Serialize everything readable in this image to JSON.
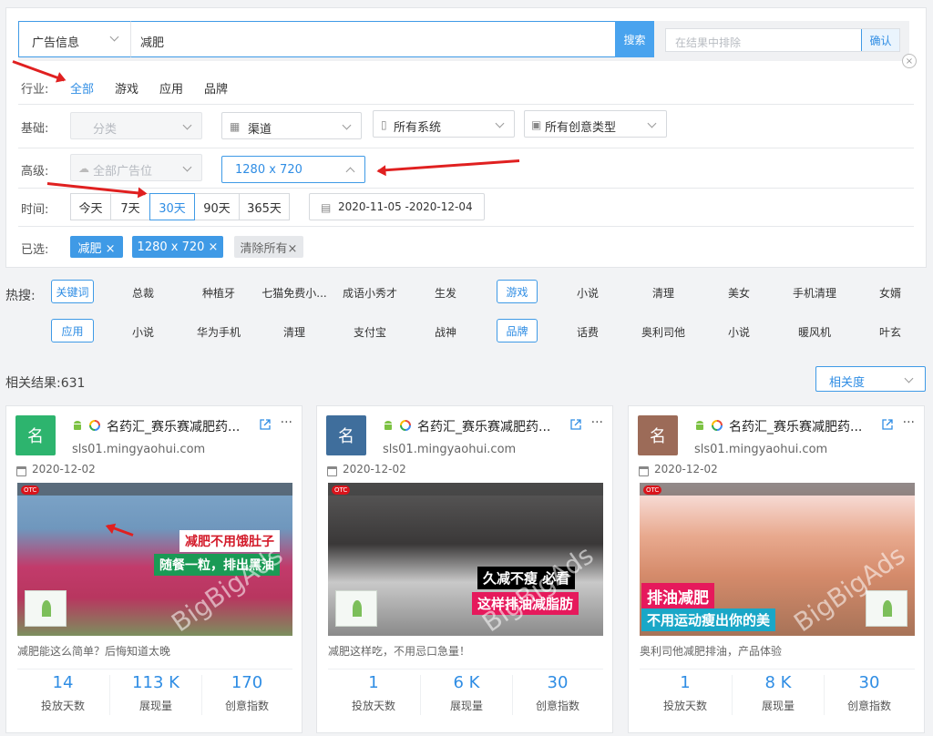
{
  "search": {
    "category": "广告信息",
    "keyword": "减肥",
    "search_label": "搜索",
    "exclude_placeholder": "在结果中排除",
    "confirm_label": "确认"
  },
  "filters": {
    "industry_label": "行业:",
    "industries": [
      "全部",
      "游戏",
      "应用",
      "品牌"
    ],
    "basic_label": "基础:",
    "basic": {
      "category": "分类",
      "channel": "渠道",
      "system": "所有系统",
      "creative_type": "所有创意类型"
    },
    "advanced_label": "高级:",
    "advanced": {
      "placement": "全部广告位",
      "size": "1280 x 720"
    },
    "time_label": "时间:",
    "times": [
      "今天",
      "7天",
      "30天",
      "90天",
      "365天"
    ],
    "date_range": "2020-11-05 -2020-12-04",
    "selected_label": "已选:",
    "selected": [
      "减肥 ×",
      "1280 x 720 ×"
    ],
    "clear_all": "清除所有×"
  },
  "hot": {
    "label": "热搜:",
    "rows": [
      {
        "tag": "关键词",
        "items": [
          "总裁",
          "种植牙",
          "七猫免费小...",
          "成语小秀才",
          "生发"
        ],
        "tag2": "游戏",
        "items2": [
          "小说",
          "清理",
          "美女",
          "手机清理",
          "女婿"
        ]
      },
      {
        "tag": "应用",
        "items": [
          "小说",
          "华为手机",
          "清理",
          "支付宝",
          "战神"
        ],
        "tag2": "品牌",
        "items2": [
          "话费",
          "奥利司他",
          "小说",
          "暖风机",
          "叶玄"
        ]
      }
    ]
  },
  "results": {
    "count_text": "相关结果:631",
    "sort": "相关度"
  },
  "cards": [
    {
      "avatar": "名",
      "avatar_color": "#2db46e",
      "title": "名药汇_赛乐赛减肥药...",
      "domain": "sls01.mingyaohui.com",
      "date": "2020-12-02",
      "caption1": "减肥不用饿肚子",
      "caption2": "随餐一粒，排出黑油",
      "desc": "减肥能这么简单？后悔知道太晚",
      "stats": [
        {
          "value": "14",
          "label": "投放天数"
        },
        {
          "value": "113 K",
          "label": "展现量"
        },
        {
          "value": "170",
          "label": "创意指数"
        }
      ]
    },
    {
      "avatar": "名",
      "avatar_color": "#3f6e9c",
      "title": "名药汇_赛乐赛减肥药...",
      "domain": "sls01.mingyaohui.com",
      "date": "2020-12-02",
      "caption1": "久减不瘦 必看",
      "caption2": "这样排油减脂肪",
      "desc": "减肥这样吃，不用忌口急量！",
      "stats": [
        {
          "value": "1",
          "label": "投放天数"
        },
        {
          "value": "6 K",
          "label": "展现量"
        },
        {
          "value": "30",
          "label": "创意指数"
        }
      ]
    },
    {
      "avatar": "名",
      "avatar_color": "#9c6b58",
      "title": "名药汇_赛乐赛减肥药...",
      "domain": "sls01.mingyaohui.com",
      "date": "2020-12-02",
      "caption1": "排油减肥",
      "caption2": "不用运动瘦出你的美",
      "desc": "奥利司他减肥排油，产品体验",
      "stats": [
        {
          "value": "1",
          "label": "投放天数"
        },
        {
          "value": "8 K",
          "label": "展现量"
        },
        {
          "value": "30",
          "label": "创意指数"
        }
      ]
    }
  ],
  "watermark": "BigBigAds",
  "otc": "OTC",
  "colors": {
    "accent": "#3f9ae6",
    "annotation_arrow": "#e02020"
  }
}
